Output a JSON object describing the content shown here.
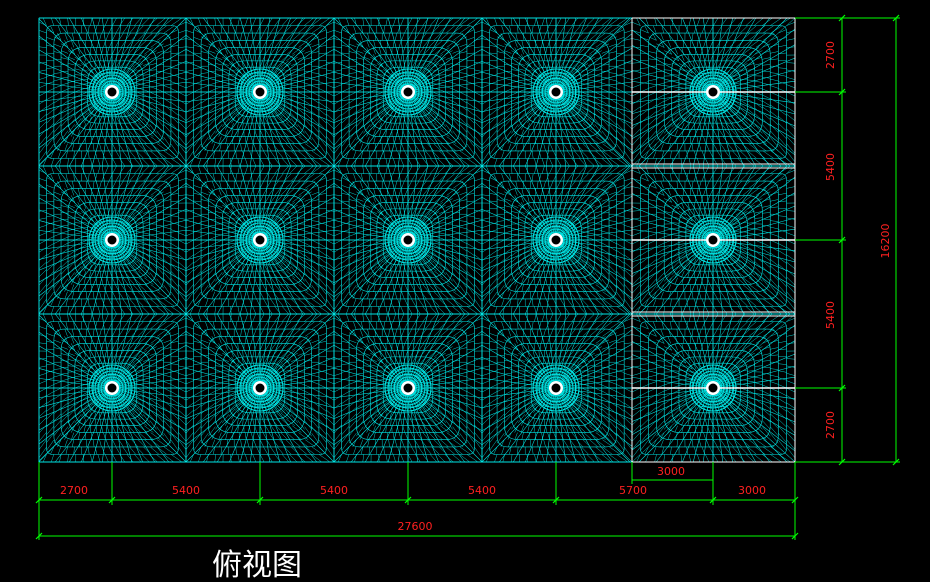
{
  "title": "俯视图",
  "colors": {
    "mesh": "#00e5e5",
    "mesh_white": "#ffffff",
    "dimension_lines": "#00ff00",
    "dimension_text": "#ff2020",
    "background": "#000000"
  },
  "dimensions": {
    "bottom": [
      "2700",
      "5400",
      "5400",
      "5400",
      "5700",
      "3000"
    ],
    "bottom_sub": "3000",
    "total_width": "27600",
    "right": [
      "2700",
      "5400",
      "5400",
      "2700"
    ],
    "total_height": "16200"
  },
  "grid": {
    "columns": 5,
    "rows": 3
  }
}
